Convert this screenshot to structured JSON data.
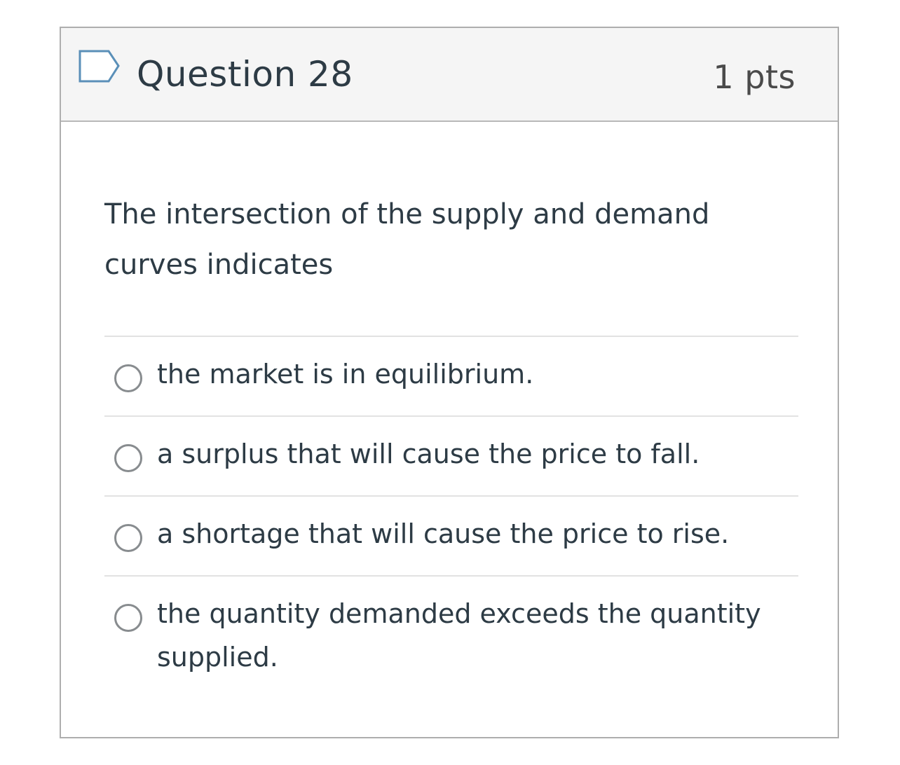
{
  "question": {
    "title": "Question 28",
    "points": "1 pts",
    "flag_icon": "flag-outline-icon",
    "text": "The intersection of the supply and demand curves indicates"
  },
  "answers": [
    {
      "label": "the market is in equilibrium.",
      "selected": false
    },
    {
      "label": "a surplus that will cause the price to fall.",
      "selected": false
    },
    {
      "label": "a shortage that will cause the price to rise.",
      "selected": false
    },
    {
      "label": "the quantity demanded exceeds the quantity supplied.",
      "selected": false
    }
  ],
  "colors": {
    "header_bg": "#f5f5f5",
    "border": "#aeaeae",
    "text": "#2d3b45",
    "flag": "#5a8fb8"
  }
}
